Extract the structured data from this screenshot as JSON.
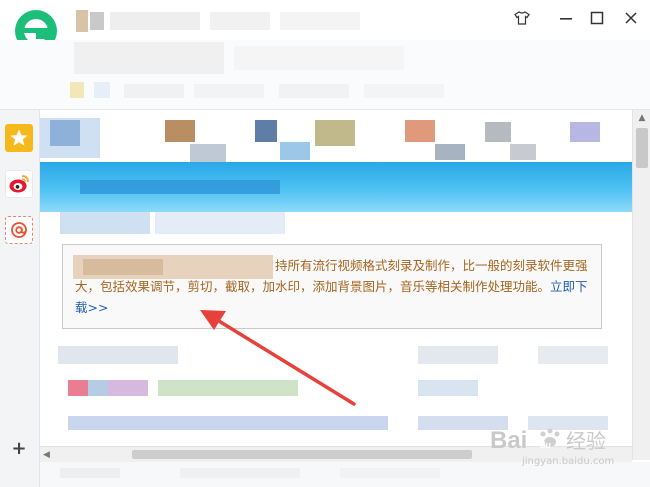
{
  "window": {
    "controls": {
      "skin_icon": "tshirt-icon",
      "minimize_icon": "minimize-icon",
      "maximize_icon": "maximize-icon",
      "close_icon": "close-icon"
    }
  },
  "logo": {
    "letter": "e",
    "color": "#1bbf7a",
    "icon": "browser-logo-icon"
  },
  "sidebar": {
    "items": [
      {
        "icon": "star-icon",
        "color": "#f6b91c"
      },
      {
        "icon": "weibo-icon",
        "color": "#e6162d"
      },
      {
        "icon": "mail-at-icon",
        "color": "#e8502f"
      }
    ],
    "add_label": "+"
  },
  "content": {
    "info_box": {
      "text": "持所有流行视频格式刻录及制作，比一般的刻录软件更强大，包括效果调节，剪切，截取，加水印，添加背景图片，音乐等相关制作处理功能。",
      "link_label": "立即下载>>"
    }
  },
  "colors": {
    "annotation_arrow": "#e8403b",
    "banner_blue": "#2aa8e6",
    "info_text": "#a5651f",
    "link": "#1f5fb0"
  },
  "watermark": {
    "brand": "Bai",
    "paw": "du",
    "suffix": "经验",
    "url": "jingyan.baidu.com"
  }
}
